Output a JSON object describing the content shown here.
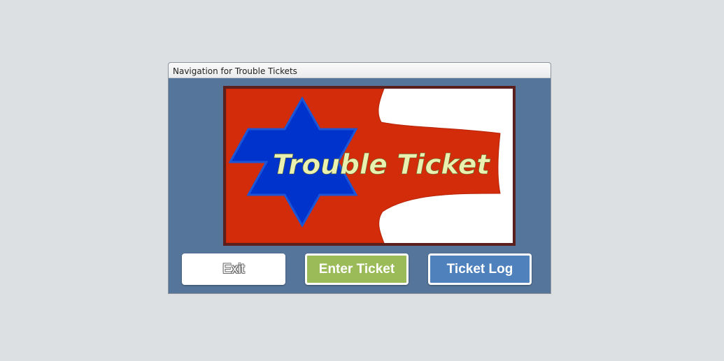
{
  "window": {
    "title": "Navigation for Trouble Tickets"
  },
  "logo": {
    "text": "Trouble Ticket",
    "colors": {
      "frame": "#5b1f1e",
      "ribbon": "#d22c0a",
      "star": "#0033cc",
      "text": "#e9f0b0"
    }
  },
  "buttons": {
    "exit_label": "Exit",
    "enter_ticket_label": "Enter Ticket",
    "ticket_log_label": "Ticket Log"
  },
  "colors": {
    "background": "#dce0e3",
    "form_background": "#55759a",
    "enter_button": "#9bbb59",
    "log_button": "#4f81bd"
  }
}
